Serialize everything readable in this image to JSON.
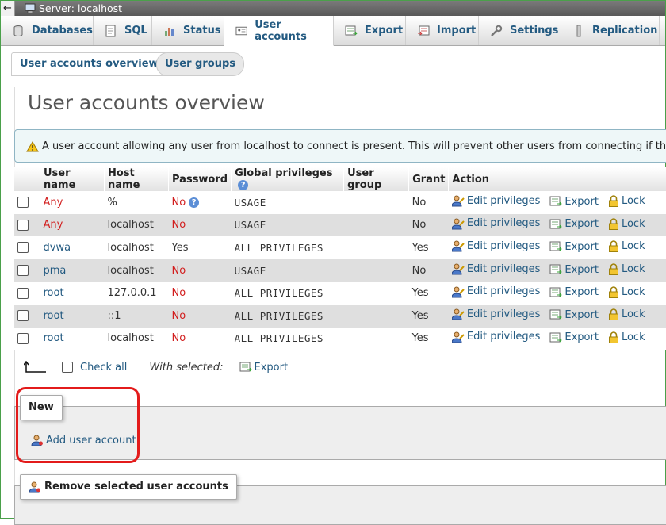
{
  "breadcrumb": {
    "back_glyph": "←",
    "server_label": "Server: localhost"
  },
  "tabs": [
    {
      "label": "Databases",
      "icon": "database-icon"
    },
    {
      "label": "SQL",
      "icon": "sql-icon"
    },
    {
      "label": "Status",
      "icon": "status-chart-icon"
    },
    {
      "label": "User accounts",
      "icon": "user-accounts-icon",
      "active": true
    },
    {
      "label": "Export",
      "icon": "export-icon"
    },
    {
      "label": "Import",
      "icon": "import-icon"
    },
    {
      "label": "Settings",
      "icon": "settings-wrench-icon"
    },
    {
      "label": "Replication",
      "icon": "replication-icon"
    }
  ],
  "subtabs": {
    "overview": "User accounts overview",
    "groups": "User groups"
  },
  "page_title": "User accounts overview",
  "notice": "A user account allowing any user from localhost to connect is present. This will prevent other users from connecting if the host part of their account allows a connection from any (%) host.",
  "table": {
    "headers": [
      "User name",
      "Host name",
      "Password",
      "Global privileges",
      "User group",
      "Grant",
      "Action"
    ],
    "actions": {
      "edit": "Edit privileges",
      "export": "Export",
      "lock": "Lock"
    },
    "rows": [
      {
        "user": "Any",
        "host": "%",
        "password": "No",
        "privileges": "USAGE",
        "group": "",
        "grant": "No",
        "user_red": true,
        "help": true
      },
      {
        "user": "Any",
        "host": "localhost",
        "password": "No",
        "privileges": "USAGE",
        "group": "",
        "grant": "No",
        "user_red": true
      },
      {
        "user": "dvwa",
        "host": "localhost",
        "password": "Yes",
        "privileges": "ALL PRIVILEGES",
        "group": "",
        "grant": "Yes"
      },
      {
        "user": "pma",
        "host": "localhost",
        "password": "No",
        "privileges": "USAGE",
        "group": "",
        "grant": "No"
      },
      {
        "user": "root",
        "host": "127.0.0.1",
        "password": "No",
        "privileges": "ALL PRIVILEGES",
        "group": "",
        "grant": "Yes"
      },
      {
        "user": "root",
        "host": "::1",
        "password": "No",
        "privileges": "ALL PRIVILEGES",
        "group": "",
        "grant": "Yes"
      },
      {
        "user": "root",
        "host": "localhost",
        "password": "No",
        "privileges": "ALL PRIVILEGES",
        "group": "",
        "grant": "Yes"
      }
    ]
  },
  "bulk": {
    "check_all": "Check all",
    "with_selected": "With selected:",
    "export": "Export"
  },
  "new_section": {
    "legend": "New",
    "add_user": "Add user account"
  },
  "remove_section": {
    "legend": "Remove selected user accounts"
  },
  "colors": {
    "link": "#235a81",
    "warning_red": "#d21e1e",
    "annotation_red": "#e31b1b",
    "frame_green": "#4aa04a"
  }
}
